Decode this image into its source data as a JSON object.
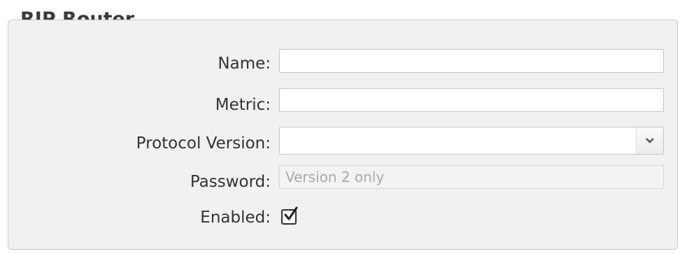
{
  "panel": {
    "title": "RIP Router"
  },
  "form": {
    "name": {
      "label": "Name:",
      "value": ""
    },
    "metric": {
      "label": "Metric:",
      "value": ""
    },
    "protocol_version": {
      "label": "Protocol Version:",
      "selected": ""
    },
    "password": {
      "label": "Password:",
      "placeholder": "Version 2 only",
      "disabled": true
    },
    "enabled": {
      "label": "Enabled:",
      "checked": true
    }
  },
  "icons": {
    "select_arrow": "chevron-down-icon",
    "checkbox_mark": "checkmark-icon"
  }
}
